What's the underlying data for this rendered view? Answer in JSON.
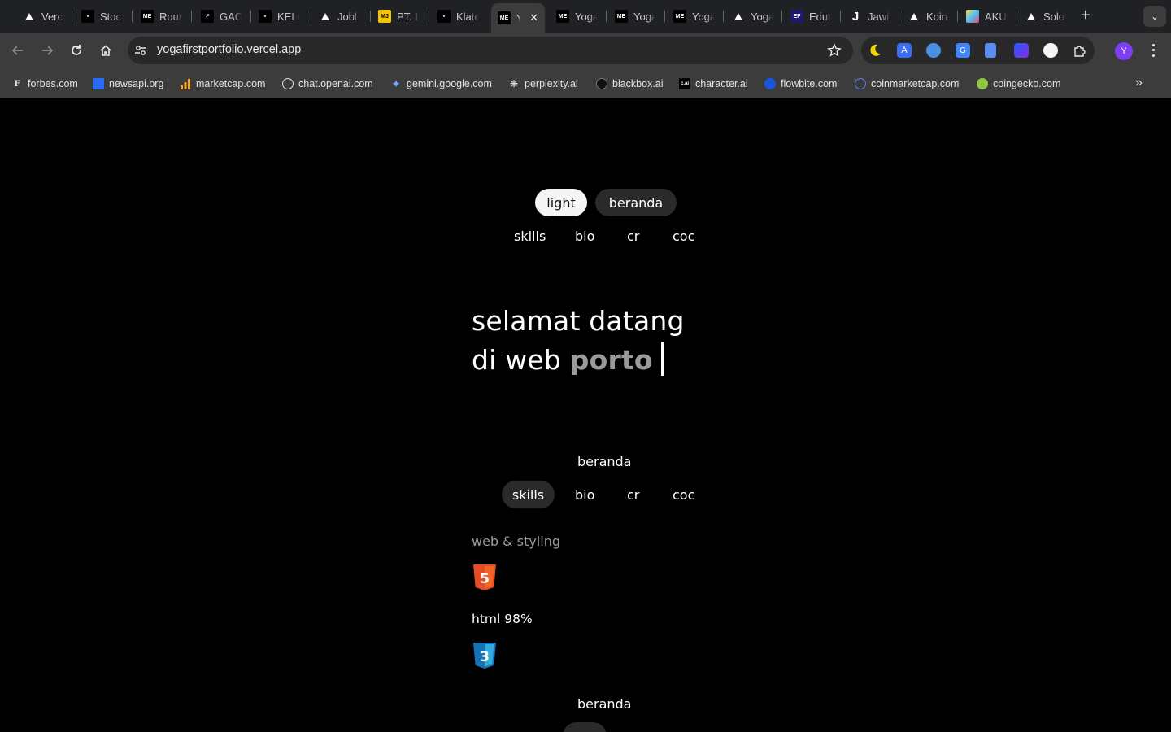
{
  "browser": {
    "tabs": [
      {
        "title": "Verc",
        "icon": "vercel-triangle-icon"
      },
      {
        "title": "Stoc",
        "icon": "dark-site-icon"
      },
      {
        "title": "Rour",
        "icon": "me-logo-icon"
      },
      {
        "title": "GAC",
        "icon": "gac-icon"
      },
      {
        "title": "KELC",
        "icon": "dark-site-icon"
      },
      {
        "title": "Jobl",
        "icon": "vercel-triangle-icon"
      },
      {
        "title": "PT. I",
        "icon": "mj-icon"
      },
      {
        "title": "Klate",
        "icon": "dark-site-icon"
      },
      {
        "title": "Y",
        "icon": "me-logo-icon",
        "active": true
      },
      {
        "title": "Yoga",
        "icon": "me-logo-icon"
      },
      {
        "title": "Yoga",
        "icon": "me-logo-icon"
      },
      {
        "title": "Yoga",
        "icon": "me-logo-icon"
      },
      {
        "title": "Yoga",
        "icon": "vercel-triangle-icon"
      },
      {
        "title": "Edut",
        "icon": "ef-icon"
      },
      {
        "title": "Jawi",
        "icon": "j-icon"
      },
      {
        "title": "Koin",
        "icon": "vercel-triangle-icon"
      },
      {
        "title": "AKU",
        "icon": "aku-icon"
      },
      {
        "title": "Solo",
        "icon": "vercel-triangle-icon"
      }
    ],
    "fav_text": {
      "me": "ME",
      "mj": "MJ",
      "ef": "EF",
      "j": "J"
    },
    "url": "yogafirstportfolio.vercel.app",
    "avatar_letter": "Y",
    "bookmarks": [
      {
        "label": "forbes.com",
        "icon": "forbes-icon"
      },
      {
        "label": "newsapi.org",
        "icon": "newsapi-icon"
      },
      {
        "label": "marketcap.com",
        "icon": "bar-chart-icon"
      },
      {
        "label": "chat.openai.com",
        "icon": "openai-icon"
      },
      {
        "label": "gemini.google.com",
        "icon": "gemini-icon"
      },
      {
        "label": "perplexity.ai",
        "icon": "perplexity-icon"
      },
      {
        "label": "blackbox.ai",
        "icon": "blackbox-icon"
      },
      {
        "label": "character.ai",
        "icon": "character-ai-icon"
      },
      {
        "label": "flowbite.com",
        "icon": "flowbite-icon"
      },
      {
        "label": "coinmarketcap.com",
        "icon": "coinmarketcap-icon"
      },
      {
        "label": "coingecko.com",
        "icon": "coingecko-icon"
      }
    ],
    "bookmark_icon_text": {
      "forbes": "F",
      "character": "c.ai"
    }
  },
  "site": {
    "theme_toggle": "light",
    "nav_top": {
      "home": "beranda",
      "skills": "skills",
      "bio": "bio",
      "cr": "cr",
      "coc": "coc"
    },
    "hero": {
      "line1": "selamat datang",
      "line2_prefix": "di web",
      "line2_highlight": "porto"
    },
    "nav_mid": {
      "home": "beranda",
      "skills": "skills",
      "bio": "bio",
      "cr": "cr",
      "coc": "coc"
    },
    "skills": {
      "heading": "web & styling",
      "items": [
        {
          "label": "html 98%",
          "icon": "html5-icon",
          "badge": "5",
          "percent": 98
        },
        {
          "icon": "css3-icon",
          "badge": "3"
        }
      ]
    },
    "nav_bottom": {
      "home": "beranda"
    }
  },
  "colors": {
    "page_bg": "#000000",
    "active_pill": "#f5f5f5",
    "dark_pill": "#2a2a2a",
    "highlight_text": "#9a9a9a",
    "html5": "#e44d26",
    "css3": "#1572b6"
  }
}
